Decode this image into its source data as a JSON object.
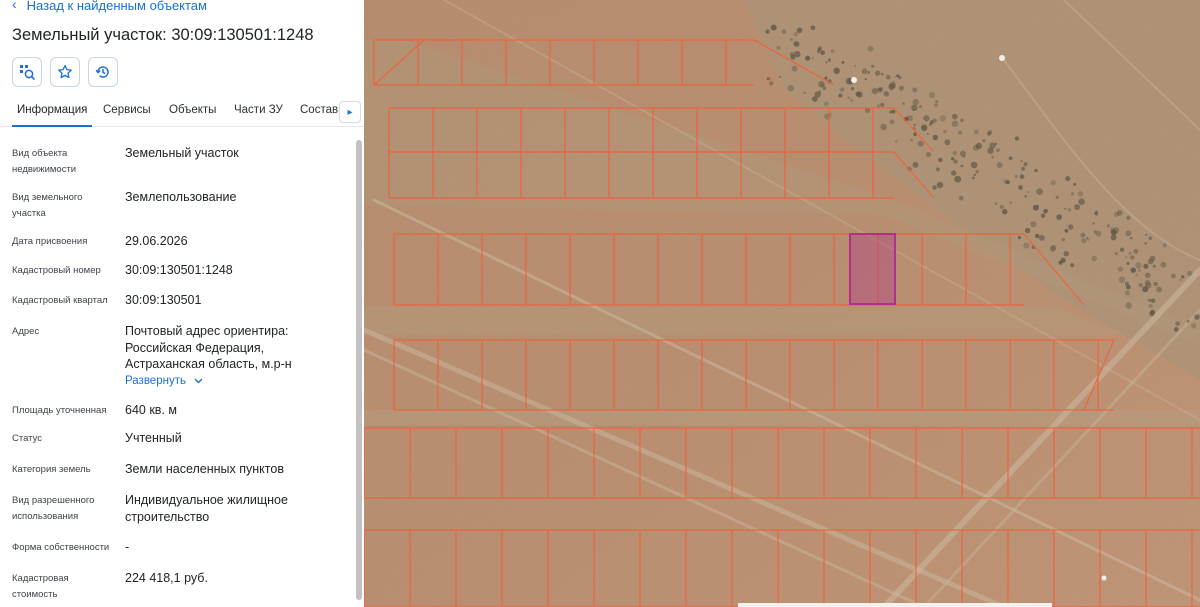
{
  "nav": {
    "back_label": "Назад к найденным объектам"
  },
  "header": {
    "title": "Земельный участок: 30:09:130501:1248"
  },
  "toolbar": {
    "buttons": [
      {
        "name": "map-locate-button",
        "icon": "locate-map-icon"
      },
      {
        "name": "favorite-button",
        "icon": "star-icon"
      },
      {
        "name": "history-button",
        "icon": "history-icon"
      }
    ]
  },
  "tabs": [
    {
      "label": "Информация",
      "active": true
    },
    {
      "label": "Сервисы",
      "active": false
    },
    {
      "label": "Объекты",
      "active": false
    },
    {
      "label": "Части ЗУ",
      "active": false
    },
    {
      "label": "Состав",
      "active": false
    }
  ],
  "info": {
    "rows": [
      {
        "label": "Вид объекта недвижимости",
        "value": "Земельный участок"
      },
      {
        "label": "Вид земельного участка",
        "value": "Землепользование"
      },
      {
        "label": "Дата присвоения",
        "value": "29.06.2026"
      },
      {
        "label": "Кадастровый номер",
        "value": "30:09:130501:1248"
      },
      {
        "label": "Кадастровый квартал",
        "value": "30:09:130501"
      },
      {
        "label": "Адрес",
        "value": "Почтовый адрес ориентира: Российская Федерация, Астраханская область, м.р-н"
      },
      {
        "label": "Площадь уточненная",
        "value": "640 кв. м"
      },
      {
        "label": "Статус",
        "value": "Учтенный"
      },
      {
        "label": "Категория земель",
        "value": "Земли населенных пунктов"
      },
      {
        "label": "Вид разрешенного использования",
        "value": "Индивидуальное жилищное строительство"
      },
      {
        "label": "Форма собственности",
        "value": "-"
      },
      {
        "label": "Кадастровая стоимость",
        "value": "224 418,1 руб."
      }
    ],
    "expand_label": "Развернуть"
  },
  "colors": {
    "accent": "#1a6fd8",
    "parcel_outline": "#f0603a",
    "selected_parcel": "#b0308c",
    "terrain": "#b8896a"
  }
}
